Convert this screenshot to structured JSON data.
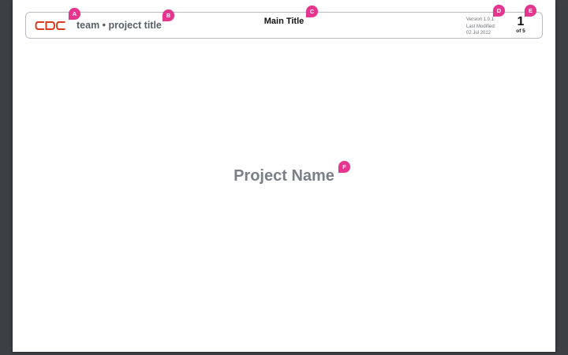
{
  "logo": {
    "text": "CDC",
    "color": "#d93a20"
  },
  "header": {
    "team_project": "team • project title",
    "main_title": "Main Title",
    "version": "Version 1.0.1",
    "last_modified_label": "Last Modified:",
    "last_modified_date": "02 Jul 2012",
    "page_current": "1",
    "page_total": "of 5"
  },
  "body": {
    "project_name": "Project Name"
  },
  "markers": {
    "a": "A",
    "b": "B",
    "c": "C",
    "d": "D",
    "e": "E",
    "f": "F"
  },
  "colors": {
    "marker": "#e6358f",
    "background": "#3c3f44",
    "page": "#ffffff",
    "project_name": "#7b7f87"
  }
}
